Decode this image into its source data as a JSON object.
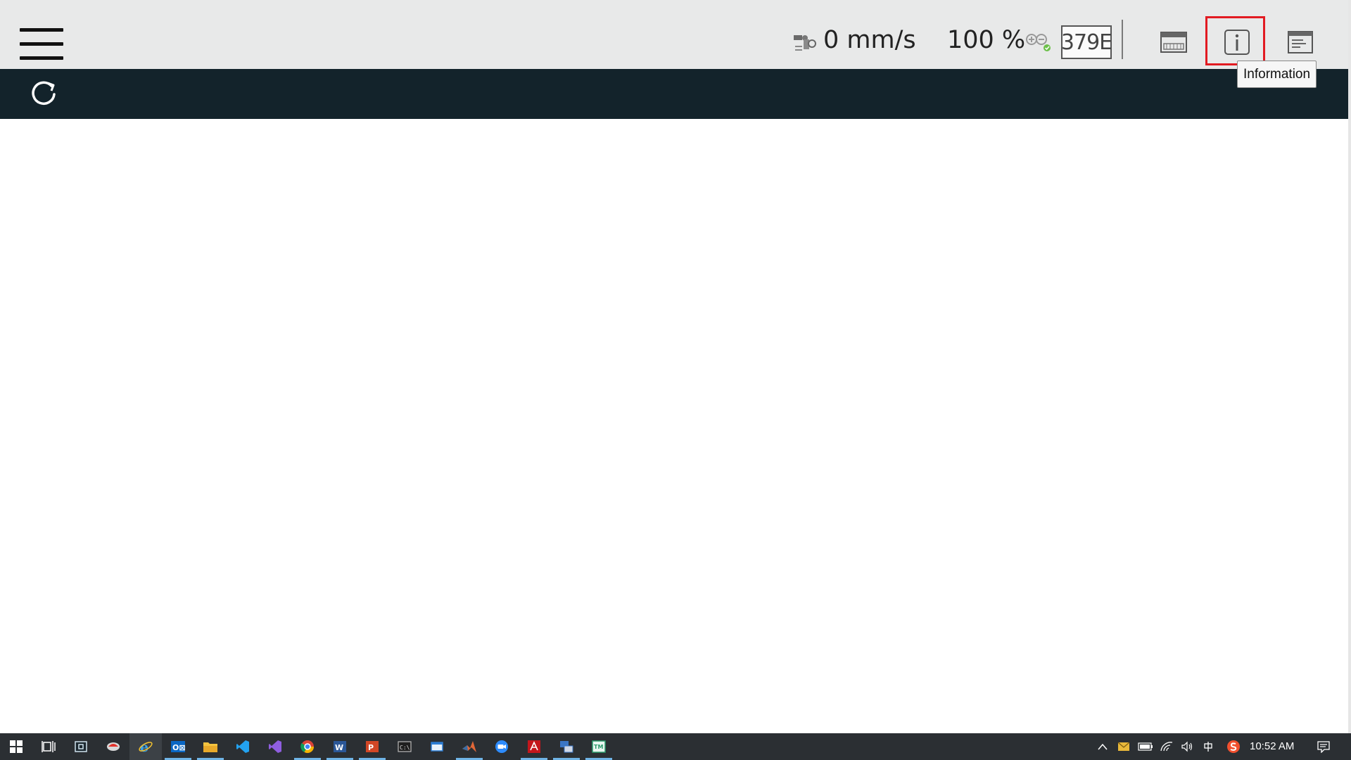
{
  "toolbar": {
    "speed": "0 mm/s",
    "zoom": "100 %",
    "code": "379E",
    "tooltip": "Information",
    "icons": [
      "menu-icon",
      "robot-speed-icon",
      "zoom-icon",
      "keyboard-icon",
      "information-icon",
      "log-window-icon"
    ],
    "highlight_color": "#e21b22"
  },
  "content": {
    "icons": [
      "refresh-icon"
    ],
    "band_color": "#13232b"
  },
  "taskbar": {
    "clock": "10:52 AM",
    "pinned_apps": [
      "start-icon",
      "task-view-icon",
      "app-manager-icon",
      "robot-studio-icon",
      "internet-explorer-icon",
      "outlook-icon",
      "file-explorer-icon",
      "vscode-icon",
      "visual-studio-icon",
      "chrome-icon",
      "word-icon",
      "powerpoint-icon",
      "terminal-icon",
      "tablet-app-icon",
      "matlab-icon",
      "zoom-app-icon",
      "acrobat-icon",
      "remote-app-icon",
      "teach-pendant-app-icon"
    ],
    "tray_icons": [
      "show-hidden-icons-chevron",
      "mail-icon",
      "battery-icon",
      "wifi-icon",
      "volume-icon",
      "input-method-icon",
      "sogou-icon",
      "notification-icon"
    ]
  }
}
